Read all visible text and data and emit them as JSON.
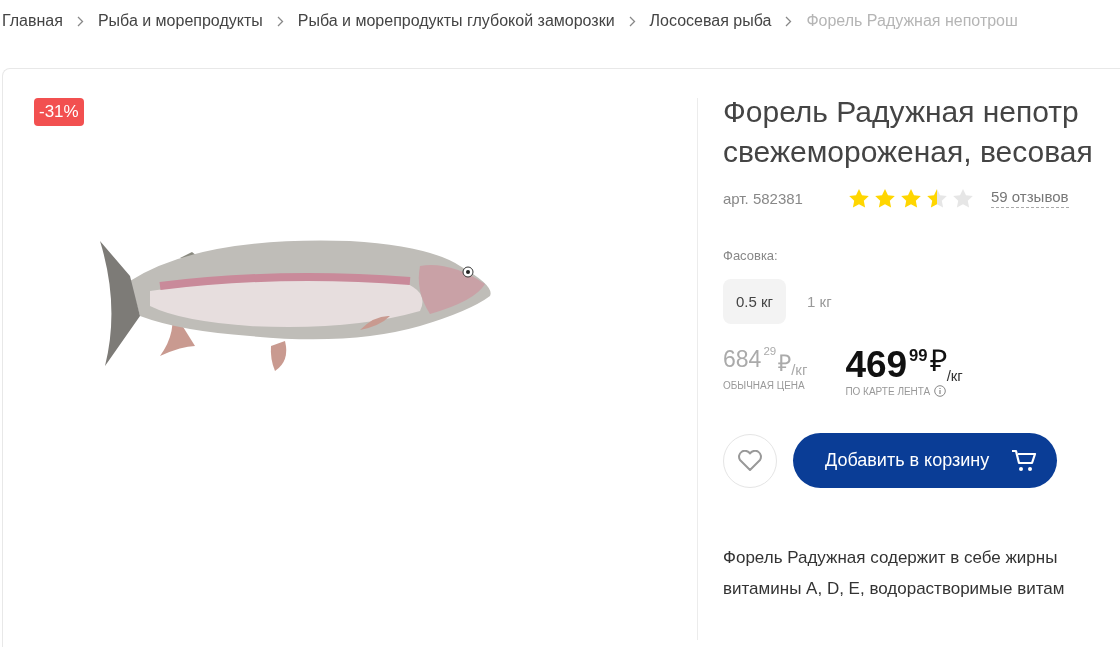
{
  "breadcrumbs": [
    {
      "label": "Главная",
      "current": false
    },
    {
      "label": "Рыба и морепродукты",
      "current": false
    },
    {
      "label": "Рыба и морепродукты глубокой заморозки",
      "current": false
    },
    {
      "label": "Лососевая рыба",
      "current": false
    },
    {
      "label": "Форель Радужная непотрош",
      "current": true
    }
  ],
  "product": {
    "discount": "-31%",
    "title_lines": [
      "Форель Радужная непотр",
      "свежемороженая, весовая"
    ],
    "article": "арт. 582381",
    "stars": 3.5,
    "reviews": "59 отзывов",
    "packing_label": "Фасовка:",
    "packing_options": [
      {
        "label": "0.5 кг",
        "selected": true
      },
      {
        "label": "1 кг",
        "selected": false
      }
    ],
    "old_price": {
      "whole": "684",
      "cents": "29",
      "currency": "₽",
      "unit": "/кг",
      "caption": "ОБЫЧНАЯ ЦЕНА"
    },
    "card_price": {
      "whole": "469",
      "cents": "99",
      "currency": "₽",
      "unit": "/кг",
      "caption": "ПО КАРТЕ ЛЕНТА"
    },
    "add_to_cart": "Добавить в корзину",
    "description_lines": [
      "Форель Радужная содержит в себе жирны",
      "витамины A, D, E, водорастворимые витам"
    ]
  }
}
